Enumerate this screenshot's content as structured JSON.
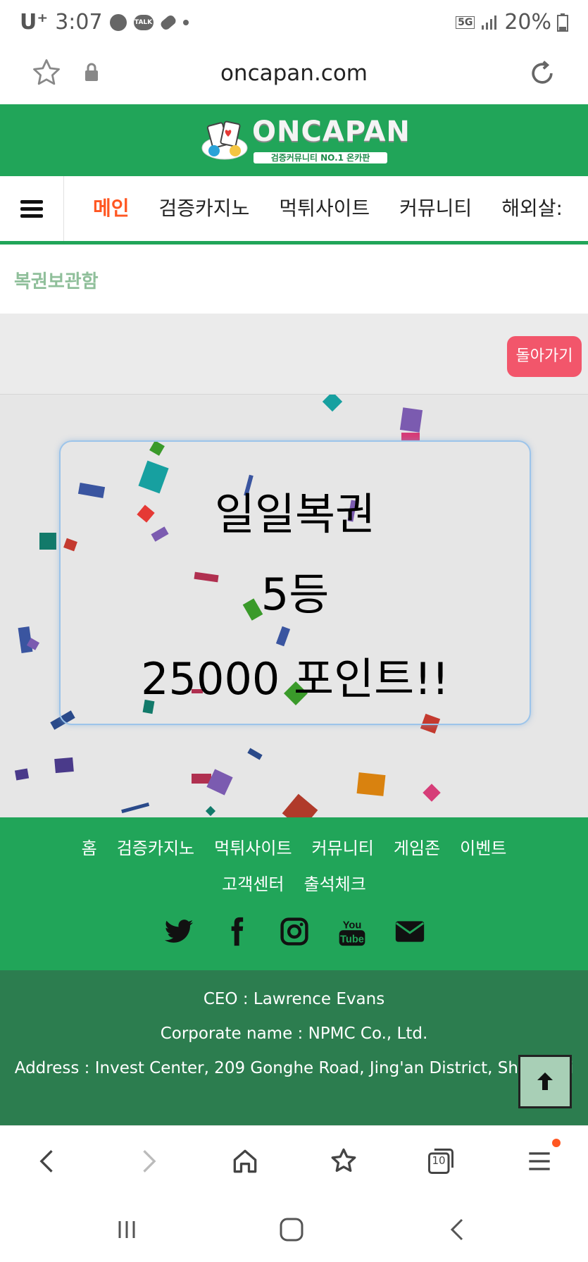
{
  "status_bar": {
    "carrier": "U⁺",
    "time": "3:07",
    "talk": "TALK",
    "network": "5G",
    "battery": "20%"
  },
  "browser": {
    "url": "oncapan.com",
    "tab_count": "10"
  },
  "header": {
    "brand": "ONCAPAN",
    "tagline": "검증커뮤니티 NO.1 온카판"
  },
  "nav": {
    "items": [
      "메인",
      "검증카지노",
      "먹튀사이트",
      "커뮤니티",
      "해외살:"
    ]
  },
  "page": {
    "section_title": "복권보관함",
    "back_button": "돌아가기"
  },
  "lotto": {
    "line1": "일일복권",
    "line2": "5등",
    "line3": "25000 포인트!!"
  },
  "footer": {
    "links": [
      "홈",
      "검증카지노",
      "먹튀사이트",
      "커뮤니티",
      "게임존",
      "이벤트",
      "고객센터",
      "출석체크"
    ],
    "ceo": "CEO : Lawrence Evans",
    "corp": "Corporate name : NPMC Co., Ltd.",
    "address": "Address : Invest Center, 209 Gonghe Road, Jing'an District, Shanghai"
  },
  "colors": {
    "green": "#21a559",
    "dark_green": "#2c7d4f",
    "active_nav": "#ff5722",
    "back_button": "#f2566b"
  }
}
